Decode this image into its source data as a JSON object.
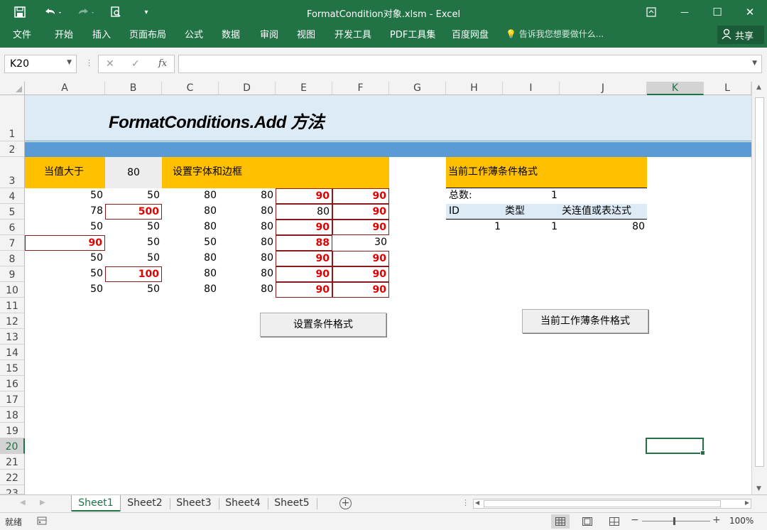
{
  "window": {
    "title": "FormatCondition对象.xlsm - Excel",
    "save_icon": "save-icon",
    "undo_icon": "undo-icon",
    "redo_icon": "redo-icon",
    "print_preview_icon": "print-preview-icon",
    "customize_icon": "customize-qat-icon",
    "ribbon_display_icon": "ribbon-display-icon",
    "minimize_glyph": "—",
    "maximize_glyph": "☐",
    "close_glyph": "✕"
  },
  "ribbon": {
    "tabs": [
      "文件",
      "开始",
      "插入",
      "页面布局",
      "公式",
      "数据",
      "审阅",
      "视图",
      "开发工具",
      "PDF工具集",
      "百度网盘"
    ],
    "search_placeholder": "告诉我您想要做什么...",
    "share_label": "共享"
  },
  "formula_bar": {
    "name_box": "K20",
    "cancel_glyph": "✕",
    "enter_glyph": "✓",
    "fx_glyph": "fx",
    "formula": ""
  },
  "columns": [
    "A",
    "B",
    "C",
    "D",
    "E",
    "F",
    "G",
    "H",
    "I",
    "J",
    "K",
    "L"
  ],
  "rows": [
    "1",
    "2",
    "3",
    "4",
    "5",
    "6",
    "7",
    "8",
    "9",
    "10",
    "11",
    "12",
    "13",
    "14",
    "15",
    "16",
    "17",
    "18",
    "19",
    "20",
    "21",
    "22",
    "23"
  ],
  "selected_cell": "K20",
  "sheet": {
    "title": "FormatConditions.Add 方法",
    "label_greater_than": "当值大于",
    "threshold": "80",
    "label_set_font_border": "设置字体和边框",
    "label_current_workbook_cf": "当前工作薄条件格式",
    "data_rows": [
      [
        "50",
        "50",
        "80",
        "80",
        "90",
        "90"
      ],
      [
        "78",
        "500",
        "80",
        "80",
        "80",
        "90"
      ],
      [
        "50",
        "50",
        "80",
        "80",
        "90",
        "90"
      ],
      [
        "90",
        "50",
        "50",
        "80",
        "88",
        "30"
      ],
      [
        "50",
        "50",
        "80",
        "80",
        "90",
        "90"
      ],
      [
        "50",
        "100",
        "80",
        "80",
        "90",
        "90"
      ],
      [
        "50",
        "50",
        "80",
        "80",
        "90",
        "90"
      ]
    ],
    "summary": {
      "total_label": "总数:",
      "total_value": "1",
      "headers": [
        "ID",
        "类型",
        "关连值或表达式"
      ],
      "row": [
        "1",
        "1",
        "80"
      ]
    },
    "buttons": {
      "set_cf": "设置条件格式",
      "current_cf": "当前工作薄条件格式"
    }
  },
  "sheet_tabs": [
    "Sheet1",
    "Sheet2",
    "Sheet3",
    "Sheet4",
    "Sheet5"
  ],
  "active_sheet": "Sheet1",
  "status": {
    "ready": "就绪",
    "zoom": "100%"
  },
  "colors": {
    "excel_green": "#217346",
    "title_band": "#ddebf7",
    "blue_band": "#5b9bd5",
    "gold": "#ffc000",
    "highlight_red": "#e00000",
    "border_dark_red": "#8b1a1a"
  }
}
